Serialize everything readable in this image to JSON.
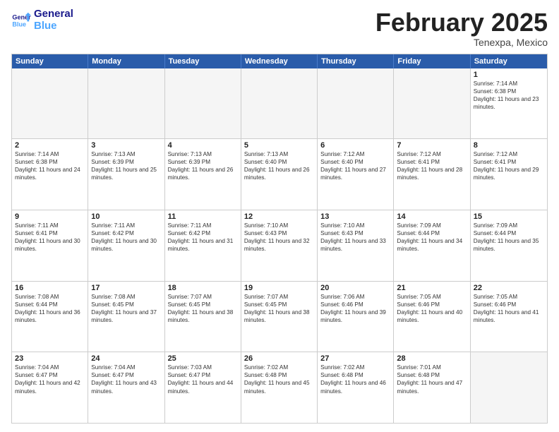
{
  "header": {
    "logo_general": "General",
    "logo_blue": "Blue",
    "month_year": "February 2025",
    "location": "Tenexpa, Mexico"
  },
  "days_of_week": [
    "Sunday",
    "Monday",
    "Tuesday",
    "Wednesday",
    "Thursday",
    "Friday",
    "Saturday"
  ],
  "weeks": [
    [
      {
        "day": "",
        "empty": true
      },
      {
        "day": "",
        "empty": true
      },
      {
        "day": "",
        "empty": true
      },
      {
        "day": "",
        "empty": true
      },
      {
        "day": "",
        "empty": true
      },
      {
        "day": "",
        "empty": true
      },
      {
        "day": "1",
        "sunrise": "Sunrise: 7:14 AM",
        "sunset": "Sunset: 6:38 PM",
        "daylight": "Daylight: 11 hours and 23 minutes."
      }
    ],
    [
      {
        "day": "2",
        "sunrise": "Sunrise: 7:14 AM",
        "sunset": "Sunset: 6:38 PM",
        "daylight": "Daylight: 11 hours and 24 minutes."
      },
      {
        "day": "3",
        "sunrise": "Sunrise: 7:13 AM",
        "sunset": "Sunset: 6:39 PM",
        "daylight": "Daylight: 11 hours and 25 minutes."
      },
      {
        "day": "4",
        "sunrise": "Sunrise: 7:13 AM",
        "sunset": "Sunset: 6:39 PM",
        "daylight": "Daylight: 11 hours and 26 minutes."
      },
      {
        "day": "5",
        "sunrise": "Sunrise: 7:13 AM",
        "sunset": "Sunset: 6:40 PM",
        "daylight": "Daylight: 11 hours and 26 minutes."
      },
      {
        "day": "6",
        "sunrise": "Sunrise: 7:12 AM",
        "sunset": "Sunset: 6:40 PM",
        "daylight": "Daylight: 11 hours and 27 minutes."
      },
      {
        "day": "7",
        "sunrise": "Sunrise: 7:12 AM",
        "sunset": "Sunset: 6:41 PM",
        "daylight": "Daylight: 11 hours and 28 minutes."
      },
      {
        "day": "8",
        "sunrise": "Sunrise: 7:12 AM",
        "sunset": "Sunset: 6:41 PM",
        "daylight": "Daylight: 11 hours and 29 minutes."
      }
    ],
    [
      {
        "day": "9",
        "sunrise": "Sunrise: 7:11 AM",
        "sunset": "Sunset: 6:41 PM",
        "daylight": "Daylight: 11 hours and 30 minutes."
      },
      {
        "day": "10",
        "sunrise": "Sunrise: 7:11 AM",
        "sunset": "Sunset: 6:42 PM",
        "daylight": "Daylight: 11 hours and 30 minutes."
      },
      {
        "day": "11",
        "sunrise": "Sunrise: 7:11 AM",
        "sunset": "Sunset: 6:42 PM",
        "daylight": "Daylight: 11 hours and 31 minutes."
      },
      {
        "day": "12",
        "sunrise": "Sunrise: 7:10 AM",
        "sunset": "Sunset: 6:43 PM",
        "daylight": "Daylight: 11 hours and 32 minutes."
      },
      {
        "day": "13",
        "sunrise": "Sunrise: 7:10 AM",
        "sunset": "Sunset: 6:43 PM",
        "daylight": "Daylight: 11 hours and 33 minutes."
      },
      {
        "day": "14",
        "sunrise": "Sunrise: 7:09 AM",
        "sunset": "Sunset: 6:44 PM",
        "daylight": "Daylight: 11 hours and 34 minutes."
      },
      {
        "day": "15",
        "sunrise": "Sunrise: 7:09 AM",
        "sunset": "Sunset: 6:44 PM",
        "daylight": "Daylight: 11 hours and 35 minutes."
      }
    ],
    [
      {
        "day": "16",
        "sunrise": "Sunrise: 7:08 AM",
        "sunset": "Sunset: 6:44 PM",
        "daylight": "Daylight: 11 hours and 36 minutes."
      },
      {
        "day": "17",
        "sunrise": "Sunrise: 7:08 AM",
        "sunset": "Sunset: 6:45 PM",
        "daylight": "Daylight: 11 hours and 37 minutes."
      },
      {
        "day": "18",
        "sunrise": "Sunrise: 7:07 AM",
        "sunset": "Sunset: 6:45 PM",
        "daylight": "Daylight: 11 hours and 38 minutes."
      },
      {
        "day": "19",
        "sunrise": "Sunrise: 7:07 AM",
        "sunset": "Sunset: 6:45 PM",
        "daylight": "Daylight: 11 hours and 38 minutes."
      },
      {
        "day": "20",
        "sunrise": "Sunrise: 7:06 AM",
        "sunset": "Sunset: 6:46 PM",
        "daylight": "Daylight: 11 hours and 39 minutes."
      },
      {
        "day": "21",
        "sunrise": "Sunrise: 7:05 AM",
        "sunset": "Sunset: 6:46 PM",
        "daylight": "Daylight: 11 hours and 40 minutes."
      },
      {
        "day": "22",
        "sunrise": "Sunrise: 7:05 AM",
        "sunset": "Sunset: 6:46 PM",
        "daylight": "Daylight: 11 hours and 41 minutes."
      }
    ],
    [
      {
        "day": "23",
        "sunrise": "Sunrise: 7:04 AM",
        "sunset": "Sunset: 6:47 PM",
        "daylight": "Daylight: 11 hours and 42 minutes."
      },
      {
        "day": "24",
        "sunrise": "Sunrise: 7:04 AM",
        "sunset": "Sunset: 6:47 PM",
        "daylight": "Daylight: 11 hours and 43 minutes."
      },
      {
        "day": "25",
        "sunrise": "Sunrise: 7:03 AM",
        "sunset": "Sunset: 6:47 PM",
        "daylight": "Daylight: 11 hours and 44 minutes."
      },
      {
        "day": "26",
        "sunrise": "Sunrise: 7:02 AM",
        "sunset": "Sunset: 6:48 PM",
        "daylight": "Daylight: 11 hours and 45 minutes."
      },
      {
        "day": "27",
        "sunrise": "Sunrise: 7:02 AM",
        "sunset": "Sunset: 6:48 PM",
        "daylight": "Daylight: 11 hours and 46 minutes."
      },
      {
        "day": "28",
        "sunrise": "Sunrise: 7:01 AM",
        "sunset": "Sunset: 6:48 PM",
        "daylight": "Daylight: 11 hours and 47 minutes."
      },
      {
        "day": "",
        "empty": true
      }
    ]
  ]
}
